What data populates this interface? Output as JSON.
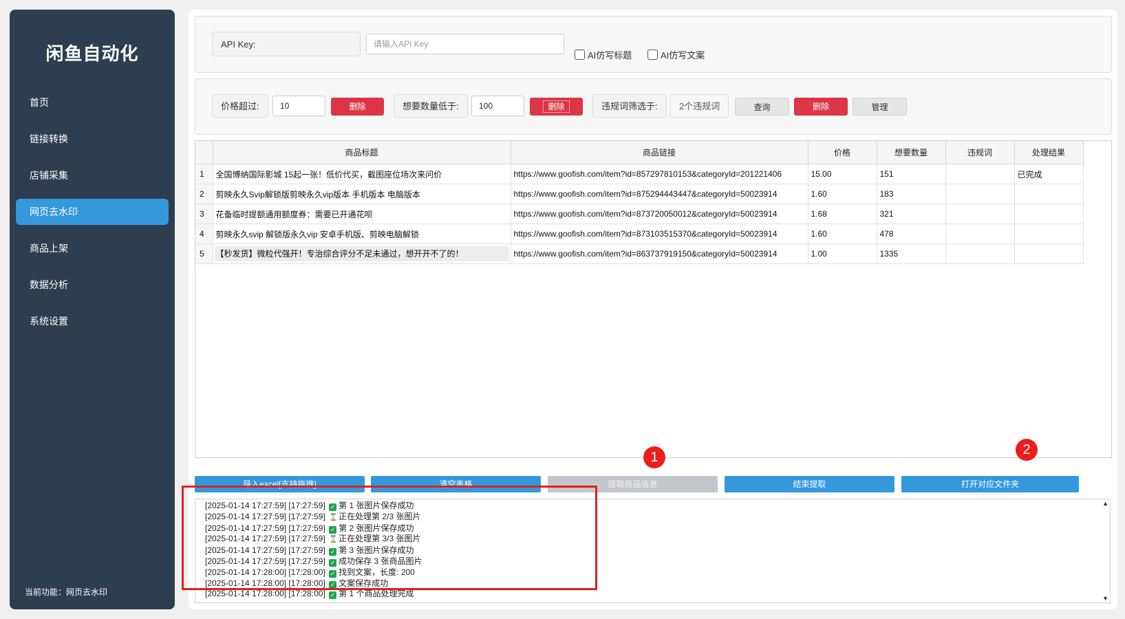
{
  "app": {
    "title": "闲鱼自动化"
  },
  "sidebar": {
    "items": [
      {
        "label": "首页"
      },
      {
        "label": "链接转换"
      },
      {
        "label": "店铺采集"
      },
      {
        "label": "网页去水印",
        "active": true
      },
      {
        "label": "商品上架"
      },
      {
        "label": "数据分析"
      },
      {
        "label": "系统设置"
      }
    ],
    "current_function": "当前功能：网页去水印"
  },
  "api": {
    "label": "API Key:",
    "placeholder": "请输入API Key",
    "value": "",
    "ai_title_label": "AI仿写标题",
    "ai_copy_label": "AI仿写文案"
  },
  "filters": {
    "price_label": "价格超过:",
    "price_value": "10",
    "delete_label": "删除",
    "want_label": "想要数量低于:",
    "want_value": "100",
    "violation_label": "违规词筛选于:",
    "violation_count": "2个违规词",
    "query_label": "查询",
    "manage_label": "管理"
  },
  "table": {
    "headers": [
      "商品标题",
      "商品链接",
      "价格",
      "想要数量",
      "违规词",
      "处理结果"
    ],
    "rows": [
      {
        "num": "1",
        "title": "全国博纳国际影城 15起一张！低价代买，截图座位场次来问价",
        "link": "https://www.goofish.com/item?id=857297810153&categoryId=201221406",
        "price": "15.00",
        "want": "151",
        "violation": "",
        "result": "已完成"
      },
      {
        "num": "2",
        "title": "剪映永久Svip解锁版剪映永久vip版本 手机版本 电脑版本",
        "link": "https://www.goofish.com/item?id=875294443447&categoryId=50023914",
        "price": "1.60",
        "want": "183",
        "violation": "",
        "result": ""
      },
      {
        "num": "3",
        "title": "花备临时提额通用额度券：需要已开通花呗",
        "link": "https://www.goofish.com/item?id=873720050012&categoryId=50023914",
        "price": "1.68",
        "want": "321",
        "violation": "",
        "result": ""
      },
      {
        "num": "4",
        "title": "剪映永久svip 解锁版永久vip 安卓手机版、剪映电脑解锁",
        "link": "https://www.goofish.com/item?id=873103515370&categoryId=50023914",
        "price": "1.60",
        "want": "478",
        "violation": "",
        "result": ""
      },
      {
        "num": "5",
        "title": "【秒发货】微粒代强开！专治综合评分不足未通过，想开开不了的！",
        "link": "https://www.goofish.com/item?id=863737919150&categoryId=50023914",
        "price": "1.00",
        "want": "1335",
        "violation": "",
        "result": ""
      }
    ]
  },
  "actions": {
    "import": "导入excel[支持拖拽]",
    "clear": "清空表格",
    "extract": "提取商品信息",
    "stop": "结束提取",
    "open_folder": "打开对应文件夹"
  },
  "markers": {
    "one": "1",
    "two": "2"
  },
  "log": [
    {
      "ts": "[2025-01-14 17:27:59] [17:27:59]",
      "icon": "check",
      "msg": "第 1 张图片保存成功"
    },
    {
      "ts": "[2025-01-14 17:27:59] [17:27:59]",
      "icon": "hourglass",
      "msg": "正在处理第 2/3 张图片"
    },
    {
      "ts": "[2025-01-14 17:27:59] [17:27:59]",
      "icon": "check",
      "msg": "第 2 张图片保存成功"
    },
    {
      "ts": "[2025-01-14 17:27:59] [17:27:59]",
      "icon": "hourglass",
      "msg": "正在处理第 3/3 张图片"
    },
    {
      "ts": "[2025-01-14 17:27:59] [17:27:59]",
      "icon": "check",
      "msg": "第 3 张图片保存成功"
    },
    {
      "ts": "[2025-01-14 17:27:59] [17:27:59]",
      "icon": "check",
      "msg": "成功保存 3 张商品图片"
    },
    {
      "ts": "[2025-01-14 17:28:00] [17:28:00]",
      "icon": "check",
      "msg": "找到文案，长度: 200"
    },
    {
      "ts": "[2025-01-14 17:28:00] [17:28:00]",
      "icon": "check",
      "msg": "文案保存成功"
    },
    {
      "ts": "[2025-01-14 17:28:00] [17:28:00]",
      "icon": "check",
      "msg": "第 1 个商品处理完成"
    }
  ],
  "colors": {
    "sidebar_bg": "#2c3e50",
    "accent": "#3498db",
    "danger": "#dc3545",
    "annotation": "#e02020"
  }
}
